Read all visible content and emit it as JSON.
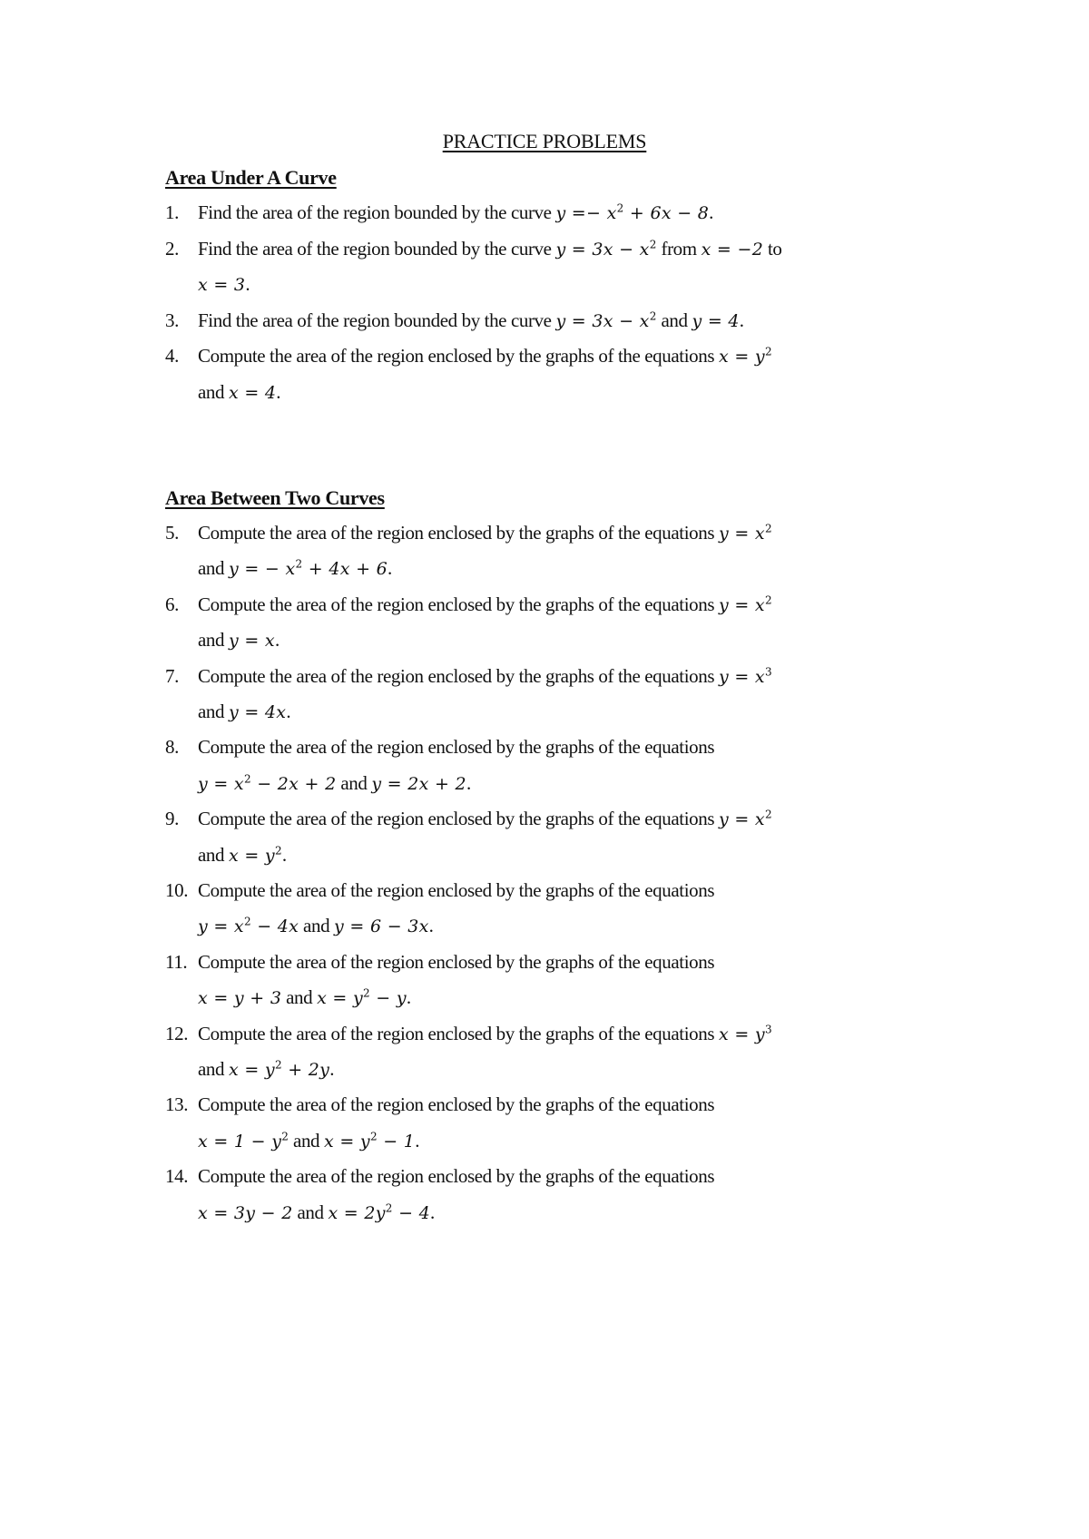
{
  "title": "PRACTICE PROBLEMS",
  "sections": [
    {
      "heading": "Area Under A Curve",
      "problems": [
        {
          "number": "1.",
          "text": "Find the area of the region bounded by the curve ",
          "math": "y =− x² + 6x − 8",
          "tail": "."
        },
        {
          "number": "2.",
          "text": "Find the area of the region bounded by the curve ",
          "math": "y = 3x − x²",
          "mid": " from ",
          "math2": "x = −2",
          "tail": " to",
          "cont_math": "x = 3",
          "cont_tail": "."
        },
        {
          "number": "3.",
          "text": "Find the area of the region bounded by the curve ",
          "math": "y = 3x − x²",
          "mid": " and ",
          "math2": "y = 4",
          "tail": "."
        },
        {
          "number": "4.",
          "text": "Compute the area of the region enclosed by the graphs of the equations ",
          "math": "x = y²",
          "cont_text": "and ",
          "cont_math": "x = 4",
          "cont_tail": "."
        }
      ]
    },
    {
      "heading": "Area Between Two Curves",
      "problems": [
        {
          "number": "5.",
          "text": "Compute the area of the region enclosed by the graphs of the equations ",
          "math": "y = x²",
          "cont_text": "and ",
          "cont_math": "y = − x² + 4x + 6",
          "cont_tail": "."
        },
        {
          "number": "6.",
          "text": "Compute the area of the region enclosed by the graphs of the equations ",
          "math": "y = x²",
          "cont_text": "and ",
          "cont_math": "y = x",
          "cont_tail": "."
        },
        {
          "number": "7.",
          "text": "Compute the area of the region enclosed by the graphs of the equations ",
          "math": "y = x³",
          "cont_text": "and ",
          "cont_math": "y = 4x",
          "cont_tail": "."
        },
        {
          "number": "8.",
          "text": "Compute the area of the region enclosed by the graphs of the equations",
          "cont_math": "y = x² − 2x + 2",
          "cont_text2": " and ",
          "cont_math2": "y = 2x + 2",
          "cont_tail": "."
        },
        {
          "number": "9.",
          "text": "Compute the area of the region enclosed by the graphs of the equations ",
          "math": "y = x²",
          "cont_text": "and ",
          "cont_math": "x = y²",
          "cont_tail": "."
        },
        {
          "number": "10.",
          "text": "Compute the area of the region enclosed by the graphs of the equations",
          "cont_math": "y = x² − 4x",
          "cont_text2": " and ",
          "cont_math2": "y = 6 − 3x",
          "cont_tail": "."
        },
        {
          "number": "11.",
          "text": "Compute the area of the region enclosed by the graphs of the equations",
          "cont_math": "x = y + 3",
          "cont_text2": " and ",
          "cont_math2": "x = y² − y",
          "cont_tail": "."
        },
        {
          "number": "12.",
          "text": "Compute the area of the region enclosed by the graphs of the equations ",
          "math": "x = y³",
          "cont_text": "and ",
          "cont_math": "x = y² + 2y",
          "cont_tail": "."
        },
        {
          "number": "13.",
          "text": "Compute the area of the region enclosed by the graphs of the equations",
          "cont_math": "x = 1 − y²",
          "cont_text2": " and ",
          "cont_math2": "x = y² − 1",
          "cont_tail": "."
        },
        {
          "number": "14.",
          "text": "Compute the area of the region enclosed by the graphs of the equations",
          "cont_math": "x = 3y − 2",
          "cont_text2": " and ",
          "cont_math2": "x = 2y² − 4",
          "cont_tail": "."
        }
      ]
    }
  ]
}
